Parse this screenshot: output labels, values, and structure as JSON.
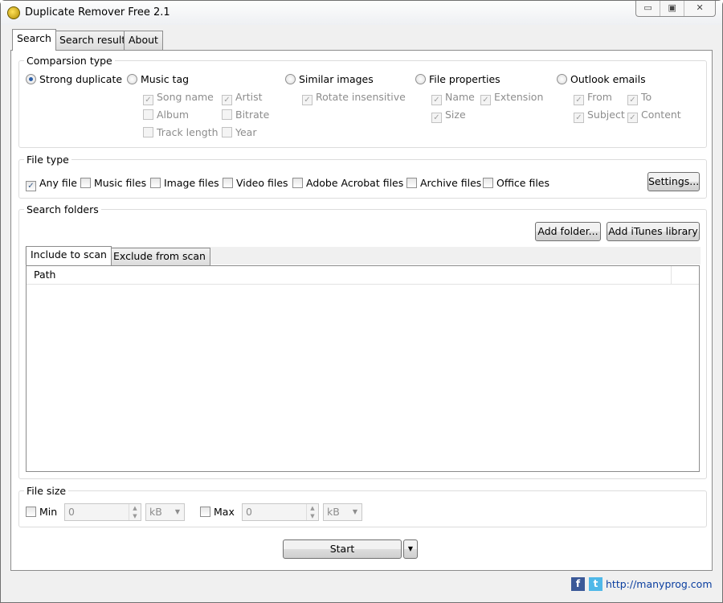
{
  "window": {
    "title": "Duplicate Remover Free 2.1",
    "controls": [
      "▭",
      "▣",
      "✕"
    ]
  },
  "tabs": [
    {
      "label": "Search"
    },
    {
      "label": "Search result"
    },
    {
      "label": "About"
    }
  ],
  "comparison": {
    "label": "Comparsion type",
    "strong": "Strong duplicate",
    "music": {
      "label": "Music tag",
      "options": [
        {
          "label": "Song name",
          "checked": true
        },
        {
          "label": "Artist",
          "checked": true
        },
        {
          "label": "Album",
          "checked": false
        },
        {
          "label": "Bitrate",
          "checked": false
        },
        {
          "label": "Track length",
          "checked": false
        },
        {
          "label": "Year",
          "checked": false
        }
      ]
    },
    "images": {
      "label": "Similar images",
      "options": [
        {
          "label": "Rotate insensitive",
          "checked": true
        }
      ]
    },
    "fileprops": {
      "label": "File properties",
      "options": [
        {
          "label": "Name",
          "checked": true
        },
        {
          "label": "Extension",
          "checked": true
        },
        {
          "label": "Size",
          "checked": true
        }
      ]
    },
    "outlook": {
      "label": "Outlook emails",
      "options": [
        {
          "label": "From",
          "checked": true
        },
        {
          "label": "To",
          "checked": true
        },
        {
          "label": "Subject",
          "checked": true
        },
        {
          "label": "Content",
          "checked": true
        }
      ]
    },
    "selected": "Strong duplicate"
  },
  "filetype": {
    "label": "File type",
    "options": [
      {
        "label": "Any file",
        "checked": true
      },
      {
        "label": "Music files",
        "checked": false
      },
      {
        "label": "Image files",
        "checked": false
      },
      {
        "label": "Video files",
        "checked": false
      },
      {
        "label": "Adobe Acrobat files",
        "checked": false
      },
      {
        "label": "Archive files",
        "checked": false
      },
      {
        "label": "Office files",
        "checked": false
      }
    ],
    "settings": "Settings..."
  },
  "folders": {
    "label": "Search folders",
    "add_folder": "Add folder...",
    "add_itunes": "Add iTunes library",
    "tabs": [
      "Include to scan",
      "Exclude from scan"
    ],
    "column": "Path"
  },
  "filesize": {
    "label": "File size",
    "min_label": "Min",
    "min_value": "0",
    "min_unit": "kB",
    "max_label": "Max",
    "max_value": "0",
    "max_unit": "kB"
  },
  "start": "Start",
  "footer": {
    "link": "http://manyprog.com",
    "facebook": "f",
    "twitter": "t"
  }
}
